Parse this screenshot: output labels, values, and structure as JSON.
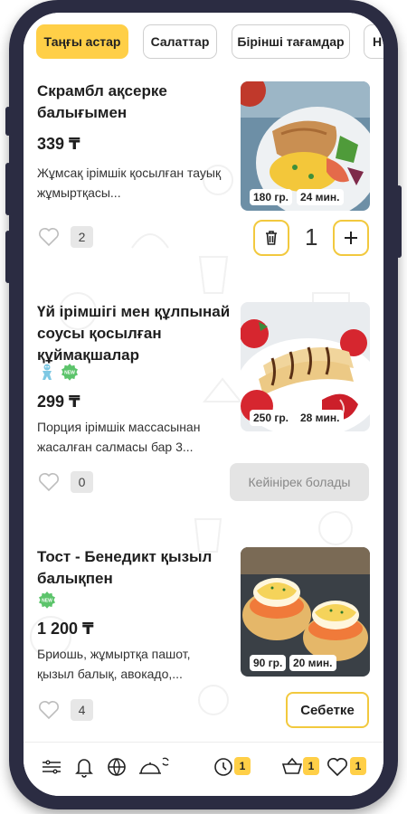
{
  "tabs": [
    {
      "label": "Таңғы астар",
      "active": true
    },
    {
      "label": "Салаттар",
      "active": false
    },
    {
      "label": "Бірінші тағамдар",
      "active": false
    },
    {
      "label": "Н",
      "active": false
    }
  ],
  "items": [
    {
      "title": "Скрамбл ақсерке балығымен",
      "price": "339 ₸",
      "description": "Жұмсақ ірімшік қосылған тауық жұмыртқасы...",
      "weight": "180 гр.",
      "time": "24 мин.",
      "likes": "2",
      "quantity": "1"
    },
    {
      "title": "Үй ірімшігі мен құлпынай соусы қосылған құймақшалар",
      "price": "299 ₸",
      "description": "Порция ірімшік массасынан жасалған салмасы бар 3...",
      "weight": "250 гр.",
      "time": "28 мин.",
      "likes": "0",
      "action_label": "Кейінірек болады",
      "badges": [
        "kids-icon",
        "new-icon"
      ]
    },
    {
      "title": "Тост - Бенедикт қызыл балықпен",
      "price": "1 200 ₸",
      "description": "Бриошь, жұмыртқа пашот, қызыл балық, авокадо,...",
      "weight": "90 гр.",
      "time": "20 мин.",
      "likes": "4",
      "action_label": "Себетке",
      "badges": [
        "new-icon"
      ]
    }
  ],
  "bottom_nav": {
    "orders_count": "1",
    "cart_count": "1",
    "favorites_count": "1"
  },
  "colors": {
    "accent": "#ffcf47",
    "frame": "#2b2c42",
    "new_badge": "#5cc46b"
  }
}
